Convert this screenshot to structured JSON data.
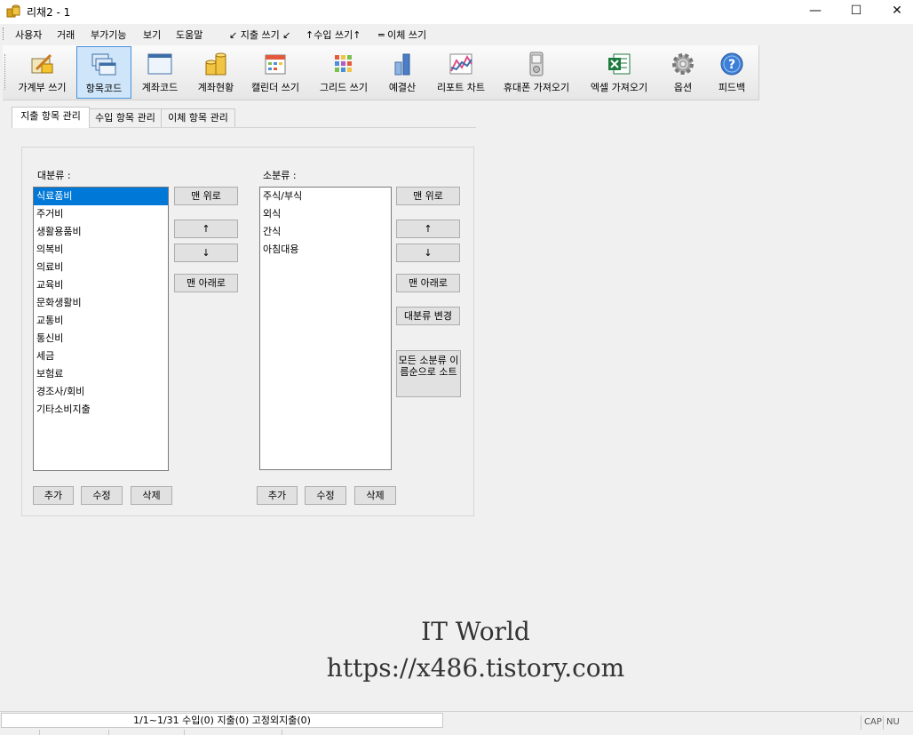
{
  "window": {
    "title": "리채2 - 1",
    "minimize": "—",
    "maximize": "☐",
    "close": "✕"
  },
  "menu": [
    "사용자",
    "거래",
    "부가기능",
    "보기",
    "도움말",
    "↙ 지출 쓰기 ↙",
    "↑수입 쓰기↑",
    "═ 이체 쓰기"
  ],
  "toolbar": [
    {
      "label": "가계부 쓰기",
      "icon": "pencil-ledger-icon"
    },
    {
      "label": "항목코드",
      "icon": "windows-stack-icon"
    },
    {
      "label": "계좌코드",
      "icon": "window-icon"
    },
    {
      "label": "계좌현황",
      "icon": "coins-icon"
    },
    {
      "label": "캘린더 쓰기",
      "icon": "calendar-icon"
    },
    {
      "label": "그리드 쓰기",
      "icon": "grid-icon"
    },
    {
      "label": "예결산",
      "icon": "bar-chart-icon"
    },
    {
      "label": "리포트 차트",
      "icon": "line-chart-icon"
    },
    {
      "label": "휴대폰 가져오기",
      "icon": "phone-icon"
    },
    {
      "label": "엑셀 가져오기",
      "icon": "excel-icon"
    },
    {
      "label": "옵션",
      "icon": "gear-icon"
    },
    {
      "label": "피드백",
      "icon": "help-icon"
    }
  ],
  "tabs": [
    "지출 항목 관리",
    "수입 항목 관리",
    "이체 항목 관리"
  ],
  "major": {
    "label": "대분류 :",
    "items": [
      "식료품비",
      "주거비",
      "생활용품비",
      "의복비",
      "의료비",
      "교육비",
      "문화생활비",
      "교통비",
      "통신비",
      "세금",
      "보험료",
      "경조사/회비",
      "기타소비지출"
    ],
    "selected_index": 0,
    "buttons": {
      "top": "맨 위로",
      "up": "↑",
      "down": "↓",
      "bottom": "맨 아래로"
    },
    "add": "추가",
    "edit": "수정",
    "delete": "삭제"
  },
  "minor": {
    "label": "소분류 :",
    "items": [
      "주식/부식",
      "외식",
      "간식",
      "아침대용"
    ],
    "buttons": {
      "top": "맨 위로",
      "up": "↑",
      "down": "↓",
      "bottom": "맨 아래로",
      "change_major": "대분류 변경",
      "sort_all": "모든 소분류 이름순으로 소트"
    },
    "add": "추가",
    "edit": "수정",
    "delete": "삭제"
  },
  "watermark": {
    "line1": "IT World",
    "line2": "https://x486.tistory.com"
  },
  "status": {
    "main": "1/1~1/31 수입(0) 지출(0) 고정외지출(0)",
    "cap": "CAP",
    "num": "NU"
  }
}
